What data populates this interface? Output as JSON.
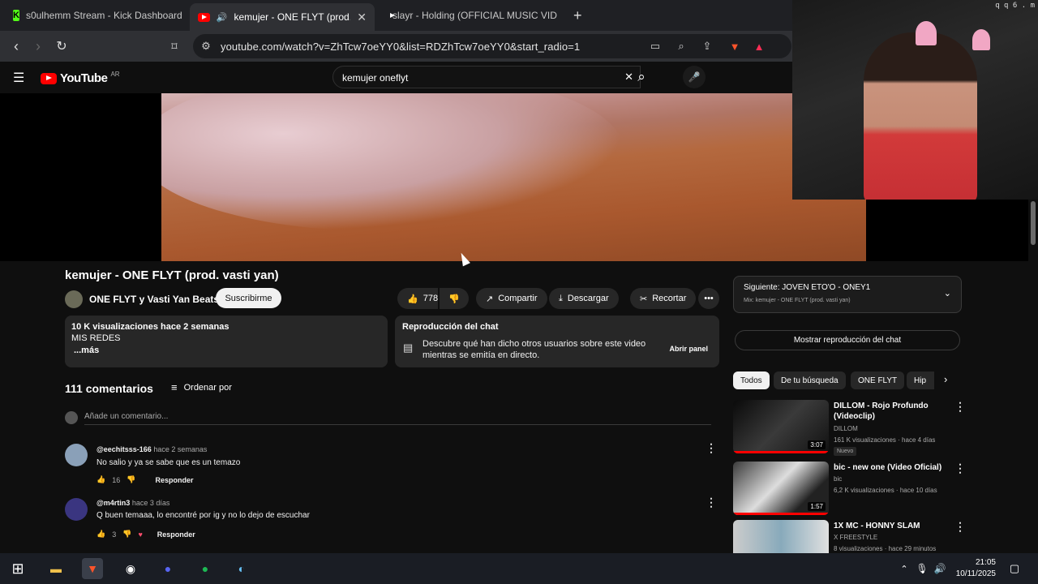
{
  "browser": {
    "tabs": [
      {
        "label": "s0ulhemm Stream - Kick Dashboard"
      },
      {
        "label": "kemujer - ONE FLYT (prod. va"
      },
      {
        "label": "slayr - Holding (OFFICIAL MUSIC VID"
      }
    ],
    "url": "youtube.com/watch?v=ZhTcw7oeYY0&list=RDZhTcw7oeYY0&start_radio=1"
  },
  "webcam": {
    "tag": "q q 6 . m"
  },
  "youtube": {
    "logo": "YouTube",
    "logo_region": "AR",
    "search_value": "kemujer oneflyt"
  },
  "video": {
    "title": "kemujer - ONE FLYT (prod. vasti yan)",
    "channel": "ONE FLYT y Vasti Yan Beats",
    "subscribe": "Suscribirme",
    "likes": "778",
    "share": "Compartir",
    "download": "Descargar",
    "clip": "Recortar",
    "views_line": "10 K visualizaciones  hace 2 semanas",
    "desc_line": "MIS REDES",
    "more": "...más"
  },
  "chat_replay": {
    "title": "Reproducción del chat",
    "text": "Descubre qué han dicho otros usuarios sobre este video mientras se emitía en directo.",
    "open": "Abrir panel"
  },
  "comments": {
    "count": "111 comentarios",
    "sort": "Ordenar por",
    "add_placeholder": "Añade un comentario...",
    "items": [
      {
        "user": "@eechitsss-166",
        "time": "hace 2 semanas",
        "text": "No salio y ya se sabe que es un temazo",
        "likes": "16",
        "reply": "Responder"
      },
      {
        "user": "@m4rtin3",
        "time": "hace 3 días",
        "text": "Q buen temaaa, lo encontré por ig y no lo dejo de escuchar",
        "likes": "3",
        "reply": "Responder"
      }
    ]
  },
  "sidebar": {
    "next_title": "Siguiente: JOVEN ETO'O - ONEY1",
    "next_sub": "Mix: kemujer - ONE FLYT (prod. vasti yan)",
    "show_chat": "Mostrar reproducción del chat",
    "chips": [
      "Todos",
      "De tu búsqueda",
      "ONE FLYT",
      "Hip"
    ],
    "videos": [
      {
        "title": "DILLOM - Rojo Profundo (Videoclip)",
        "channel": "DILLOM",
        "meta": "161 K visualizaciones · hace 4 días",
        "badge": "Nuevo",
        "duration": "3:07"
      },
      {
        "title": "bic - new one (Video Oficial)",
        "channel": "bic",
        "meta": "6,2 K visualizaciones · hace 10 días",
        "duration": "1:57"
      },
      {
        "title": "1X MC - HONNY SLAM",
        "channel": "X FREESTYLE",
        "meta": "8 visualizaciones · hace 29 minutos"
      }
    ]
  },
  "taskbar": {
    "time": "21:05",
    "date": "10/11/2025"
  }
}
